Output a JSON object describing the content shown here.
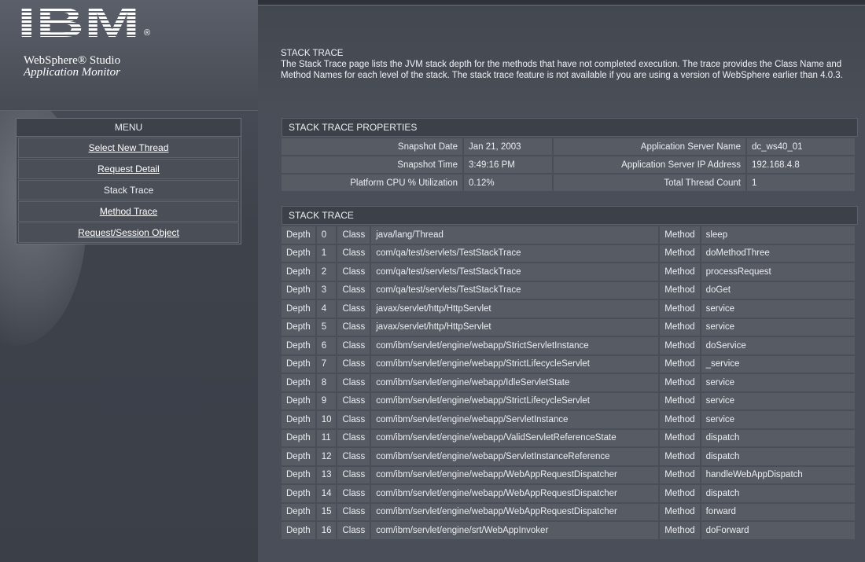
{
  "brand": {
    "logo_text": "IBM",
    "registered": "®",
    "product_line1": "WebSphere® Studio",
    "product_line2": "Application Monitor"
  },
  "menu": {
    "title": "MENU",
    "items": [
      {
        "label": "Select New Thread",
        "active": false
      },
      {
        "label": "Request Detail",
        "active": false
      },
      {
        "label": "Stack Trace",
        "active": true
      },
      {
        "label": "Method Trace",
        "active": false
      },
      {
        "label": "Request/Session Object",
        "active": false
      }
    ]
  },
  "intro": {
    "title": "STACK TRACE",
    "description": "The Stack Trace page lists the JVM stack depth for the methods that have not completed execution. The trace provides the Class Name and Method Names for each level of the stack. The stack trace feature is not available if you are using a version of WebSphere earlier than 4.0.3."
  },
  "properties": {
    "header": "STACK TRACE PROPERTIES",
    "rows": [
      {
        "label1": "Snapshot Date",
        "value1": "Jan 21, 2003",
        "label2": "Application Server Name",
        "value2": "dc_ws40_01"
      },
      {
        "label1": "Snapshot Time",
        "value1": "3:49:16 PM",
        "label2": "Application Server IP Address",
        "value2": "192.168.4.8"
      },
      {
        "label1": "Platform CPU % Utilization",
        "value1": "0.12%",
        "label2": "Total Thread Count",
        "value2": "1"
      }
    ]
  },
  "trace": {
    "header": "STACK TRACE",
    "depth_label": "Depth",
    "class_label": "Class",
    "method_label": "Method",
    "rows": [
      {
        "depth": "0",
        "class": "java/lang/Thread",
        "method": "sleep"
      },
      {
        "depth": "1",
        "class": "com/qa/test/servlets/TestStackTrace",
        "method": "doMethodThree"
      },
      {
        "depth": "2",
        "class": "com/qa/test/servlets/TestStackTrace",
        "method": "processRequest"
      },
      {
        "depth": "3",
        "class": "com/qa/test/servlets/TestStackTrace",
        "method": "doGet"
      },
      {
        "depth": "4",
        "class": "javax/servlet/http/HttpServlet",
        "method": "service"
      },
      {
        "depth": "5",
        "class": "javax/servlet/http/HttpServlet",
        "method": "service"
      },
      {
        "depth": "6",
        "class": "com/ibm/servlet/engine/webapp/StrictServletInstance",
        "method": "doService"
      },
      {
        "depth": "7",
        "class": "com/ibm/servlet/engine/webapp/StrictLifecycleServlet",
        "method": "_service"
      },
      {
        "depth": "8",
        "class": "com/ibm/servlet/engine/webapp/IdleServletState",
        "method": "service"
      },
      {
        "depth": "9",
        "class": "com/ibm/servlet/engine/webapp/StrictLifecycleServlet",
        "method": "service"
      },
      {
        "depth": "10",
        "class": "com/ibm/servlet/engine/webapp/ServletInstance",
        "method": "service"
      },
      {
        "depth": "11",
        "class": "com/ibm/servlet/engine/webapp/ValidServletReferenceState",
        "method": "dispatch"
      },
      {
        "depth": "12",
        "class": "com/ibm/servlet/engine/webapp/ServletInstanceReference",
        "method": "dispatch"
      },
      {
        "depth": "13",
        "class": "com/ibm/servlet/engine/webapp/WebAppRequestDispatcher",
        "method": "handleWebAppDispatch"
      },
      {
        "depth": "14",
        "class": "com/ibm/servlet/engine/webapp/WebAppRequestDispatcher",
        "method": "dispatch"
      },
      {
        "depth": "15",
        "class": "com/ibm/servlet/engine/webapp/WebAppRequestDispatcher",
        "method": "forward"
      },
      {
        "depth": "16",
        "class": "com/ibm/servlet/engine/srt/WebAppInvoker",
        "method": "doForward"
      }
    ]
  }
}
